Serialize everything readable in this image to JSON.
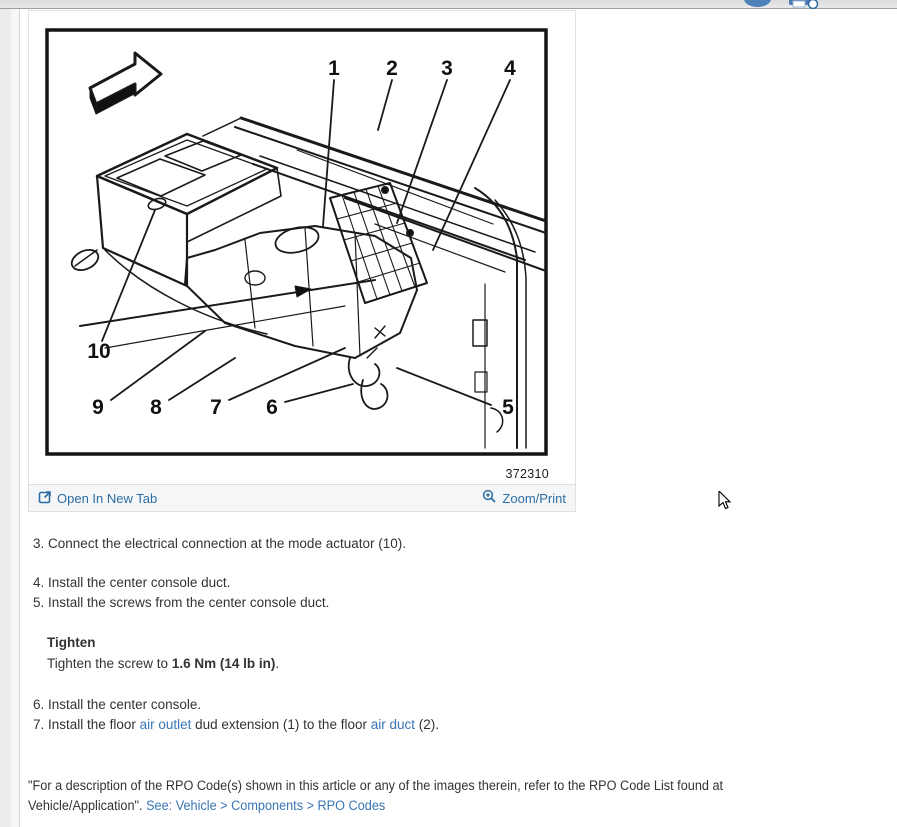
{
  "header": {
    "icons": [
      "avatar-icon",
      "printer-icon"
    ]
  },
  "figure_panel": {
    "figure_number": "372310",
    "callouts": {
      "c1": "1",
      "c2": "2",
      "c3": "3",
      "c4": "4",
      "c5": "5",
      "c6": "6",
      "c7": "7",
      "c8": "8",
      "c9": "9",
      "c10": "10"
    },
    "toolbar": {
      "open_label": "Open In New Tab",
      "zoom_label": "Zoom/Print",
      "open_icon": "open-in-new-tab-icon",
      "zoom_icon": "zoom-magnifier-icon"
    }
  },
  "steps": {
    "s3_num": "3.",
    "s3_text": "Connect the electrical connection at the mode actuator (10).",
    "s4_num": "4.",
    "s4_text": "Install the center console duct.",
    "s5_num": "5.",
    "s5_text": "Install the screws from the center console duct.",
    "tighten_heading": "Tighten",
    "tighten_prefix": "Tighten the screw to ",
    "tighten_bold": "1.6 Nm (14 lb in)",
    "tighten_suffix": ".",
    "s6_num": "6.",
    "s6_text": "Install the center console.",
    "s7_num": "7.",
    "s7_prefix": "Install the floor ",
    "s7_link1": "air outlet",
    "s7_mid": " dud extension (1) to the floor ",
    "s7_link2": "air duct",
    "s7_suffix": " (2)."
  },
  "footer": {
    "note_line1": "\"For a description of the RPO Code(s) shown in this article or any of the images therein, refer to the RPO Code List found at",
    "note_line2": "Vehicle/Application\". ",
    "link": "See: Vehicle > Components > RPO Codes"
  },
  "colors": {
    "link_blue": "#3a76b4",
    "toolbar_blue": "#2d6da3",
    "body_text": "#333333",
    "panel_border": "#e2e2e2"
  }
}
